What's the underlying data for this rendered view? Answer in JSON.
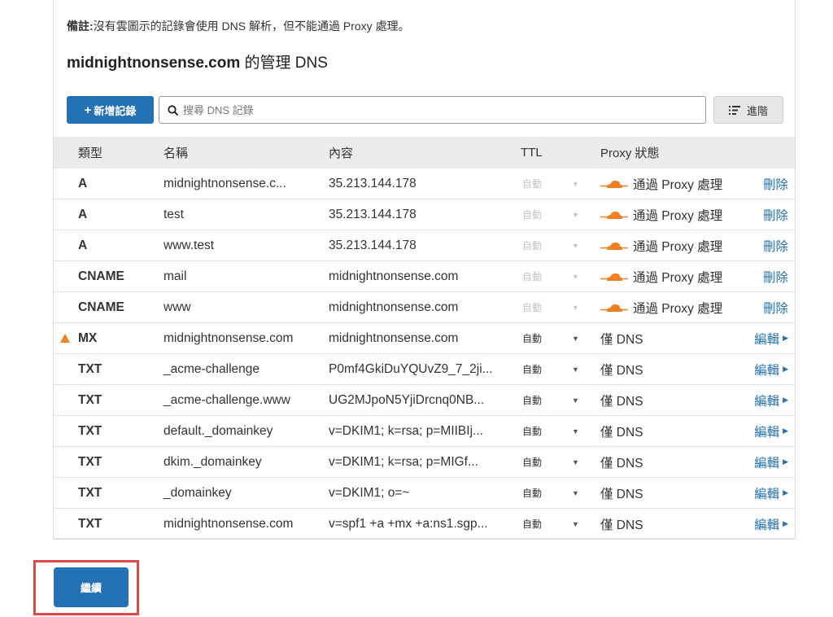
{
  "note": {
    "label": "備註:",
    "text": "沒有雲圖示的記錄會使用 DNS 解析，但不能通過 Proxy 處理。"
  },
  "zone": {
    "domain": "midnightnonsense.com",
    "suffix": " 的管理 DNS"
  },
  "toolbar": {
    "add_label": "新增記錄",
    "search_placeholder": "搜尋 DNS 記錄",
    "advanced_label": "進階"
  },
  "table": {
    "headers": {
      "type": "類型",
      "name": "名稱",
      "content": "內容",
      "ttl": "TTL",
      "proxy": "Proxy 狀態"
    },
    "rows": [
      {
        "warn": false,
        "type": "A",
        "name": "midnightnonsense.c...",
        "content": "35.213.144.178",
        "ttl": "自動",
        "proxy": "通過 Proxy 處理",
        "proxied": true,
        "action": "刪除"
      },
      {
        "warn": false,
        "type": "A",
        "name": "test",
        "content": "35.213.144.178",
        "ttl": "自動",
        "proxy": "通過 Proxy 處理",
        "proxied": true,
        "action": "刪除"
      },
      {
        "warn": false,
        "type": "A",
        "name": "www.test",
        "content": "35.213.144.178",
        "ttl": "自動",
        "proxy": "通過 Proxy 處理",
        "proxied": true,
        "action": "刪除"
      },
      {
        "warn": false,
        "type": "CNAME",
        "name": "mail",
        "content": "midnightnonsense.com",
        "ttl": "自動",
        "proxy": "通過 Proxy 處理",
        "proxied": true,
        "action": "刪除"
      },
      {
        "warn": false,
        "type": "CNAME",
        "name": "www",
        "content": "midnightnonsense.com",
        "ttl": "自動",
        "proxy": "通過 Proxy 處理",
        "proxied": true,
        "action": "刪除"
      },
      {
        "warn": true,
        "type": "MX",
        "name": "midnightnonsense.com",
        "content": "midnightnonsense.com",
        "ttl": "自動",
        "proxy": "僅 DNS",
        "proxied": false,
        "action": "編輯"
      },
      {
        "warn": false,
        "type": "TXT",
        "name": "_acme-challenge",
        "content": "P0mf4GkiDuYQUvZ9_7_2ji...",
        "ttl": "自動",
        "proxy": "僅 DNS",
        "proxied": false,
        "action": "編輯"
      },
      {
        "warn": false,
        "type": "TXT",
        "name": "_acme-challenge.www",
        "content": "UG2MJpoN5YjiDrcnq0NB...",
        "ttl": "自動",
        "proxy": "僅 DNS",
        "proxied": false,
        "action": "編輯"
      },
      {
        "warn": false,
        "type": "TXT",
        "name": "default._domainkey",
        "content": "v=DKIM1; k=rsa; p=MIIBIj...",
        "ttl": "自動",
        "proxy": "僅 DNS",
        "proxied": false,
        "action": "編輯"
      },
      {
        "warn": false,
        "type": "TXT",
        "name": "dkim._domainkey",
        "content": "v=DKIM1; k=rsa; p=MIGf...",
        "ttl": "自動",
        "proxy": "僅 DNS",
        "proxied": false,
        "action": "編輯"
      },
      {
        "warn": false,
        "type": "TXT",
        "name": "_domainkey",
        "content": "v=DKIM1; o=~",
        "ttl": "自動",
        "proxy": "僅 DNS",
        "proxied": false,
        "action": "編輯"
      },
      {
        "warn": false,
        "type": "TXT",
        "name": "midnightnonsense.com",
        "content": "v=spf1 +a +mx +a:ns1.sgp...",
        "ttl": "自動",
        "proxy": "僅 DNS",
        "proxied": false,
        "action": "編輯"
      }
    ]
  },
  "footer": {
    "save_label": "繼續"
  },
  "colors": {
    "accent": "#2372b6",
    "cloud": "#f38020",
    "warning": "#f38020",
    "highlight": "#e04a4a"
  }
}
